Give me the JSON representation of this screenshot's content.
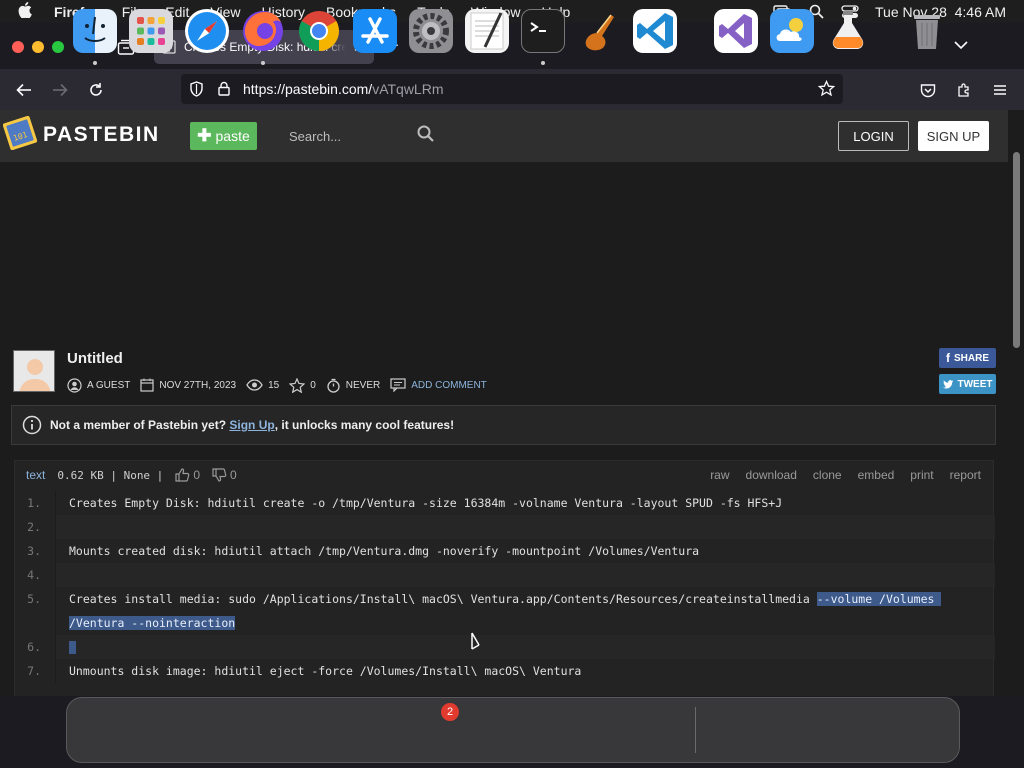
{
  "menubar": {
    "app_name": "Firefox",
    "items": [
      "File",
      "Edit",
      "View",
      "History",
      "Bookmarks",
      "Tools",
      "Window",
      "Help"
    ],
    "clock": "Tue Nov 28  4:46 AM"
  },
  "browser": {
    "tab_title": "Creates Empty Disk: hdiutil create -o /tmp/Ventura",
    "url_host": "https://pastebin.com/",
    "url_path": "vATqwLRm"
  },
  "site": {
    "logo_text": "PASTEBIN",
    "paste_label": "paste",
    "search_placeholder": "Search...",
    "login_label": "LOGIN",
    "signup_label": "SIGN UP"
  },
  "paste": {
    "title": "Untitled",
    "author": "A GUEST",
    "date": "NOV 27TH, 2023",
    "views": "15",
    "stars": "0",
    "expires": "NEVER",
    "add_comment": "ADD COMMENT",
    "share_fb": "SHARE",
    "share_tw": "TWEET"
  },
  "notice": {
    "prefix": "Not a member of Pastebin yet?",
    "link": "Sign Up",
    "suffix": ", it unlocks many cool features!"
  },
  "code_header": {
    "syntax": "text",
    "size": "0.62 KB | None |",
    "likes": "0",
    "dislikes": "0",
    "actions": [
      "raw",
      "download",
      "clone",
      "embed",
      "print",
      "report"
    ]
  },
  "code_lines": [
    {
      "n": "1.",
      "text": "Creates Empty Disk: hdiutil create -o /tmp/Ventura -size 16384m -volname Ventura -layout SPUD -fs HFS+J"
    },
    {
      "n": "2.",
      "text": ""
    },
    {
      "n": "3.",
      "text": "Mounts created disk: hdiutil attach /tmp/Ventura.dmg -noverify -mountpoint /Volumes/Ventura"
    },
    {
      "n": "4.",
      "text": ""
    },
    {
      "n": "5.",
      "text": "Creates install media: sudo /Applications/Install\\ macOS\\ Ventura.app/Contents/Resources/createinstallmedia ",
      "highlight": "--volume /Volumes /Ventura --nointeraction"
    },
    {
      "n": "6.",
      "text": ""
    },
    {
      "n": "7.",
      "text": "Unmounts disk image: hdiutil eject -force /Volumes/Install\\ macOS\\ Ventura"
    }
  ],
  "dock": {
    "apps": [
      "Finder",
      "Launchpad",
      "Safari",
      "Firefox",
      "Chrome",
      "App Store",
      "System Settings",
      "TextEdit",
      "Terminal",
      "Instruments",
      "Visual Studio Code",
      "Visual Studio",
      "Weather",
      "Utility",
      "Trash"
    ],
    "settings_badge": "2"
  }
}
